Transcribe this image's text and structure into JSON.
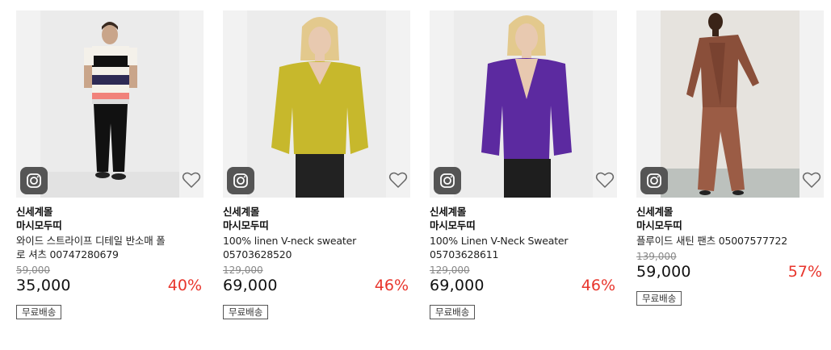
{
  "products": [
    {
      "store": "신세계몰",
      "brand": "마시모두띠",
      "name_line1": "와이드 스트라이프 디테일 반소매 폴",
      "name_line2": "로 셔츠 00747280679",
      "original_price": "59,000",
      "price": "35,000",
      "discount": "40%",
      "badge": "무료배송",
      "instagram_icon": "instagram-icon",
      "wishlist_icon": "heart-icon"
    },
    {
      "store": "신세계몰",
      "brand": "마시모두띠",
      "name_line1": "100% linen V-neck sweater",
      "name_line2": "05703628520",
      "original_price": "129,000",
      "price": "69,000",
      "discount": "46%",
      "badge": "무료배송",
      "instagram_icon": "instagram-icon",
      "wishlist_icon": "heart-icon"
    },
    {
      "store": "신세계몰",
      "brand": "마시모두띠",
      "name_line1": "100% Linen V-Neck Sweater",
      "name_line2": "05703628611",
      "original_price": "129,000",
      "price": "69,000",
      "discount": "46%",
      "badge": "무료배송",
      "instagram_icon": "instagram-icon",
      "wishlist_icon": "heart-icon"
    },
    {
      "store": "신세계몰",
      "brand": "마시모두띠",
      "name_line1": "플루이드 새틴 팬츠 05007577722",
      "name_line2": "",
      "original_price": "139,000",
      "price": "59,000",
      "discount": "57%",
      "badge": "무료배송",
      "instagram_icon": "instagram-icon",
      "wishlist_icon": "heart-icon"
    }
  ],
  "colors": {
    "discount": "#e8352c",
    "thumb_bg": "#f2f2f2",
    "insta_bg": "#555555"
  }
}
